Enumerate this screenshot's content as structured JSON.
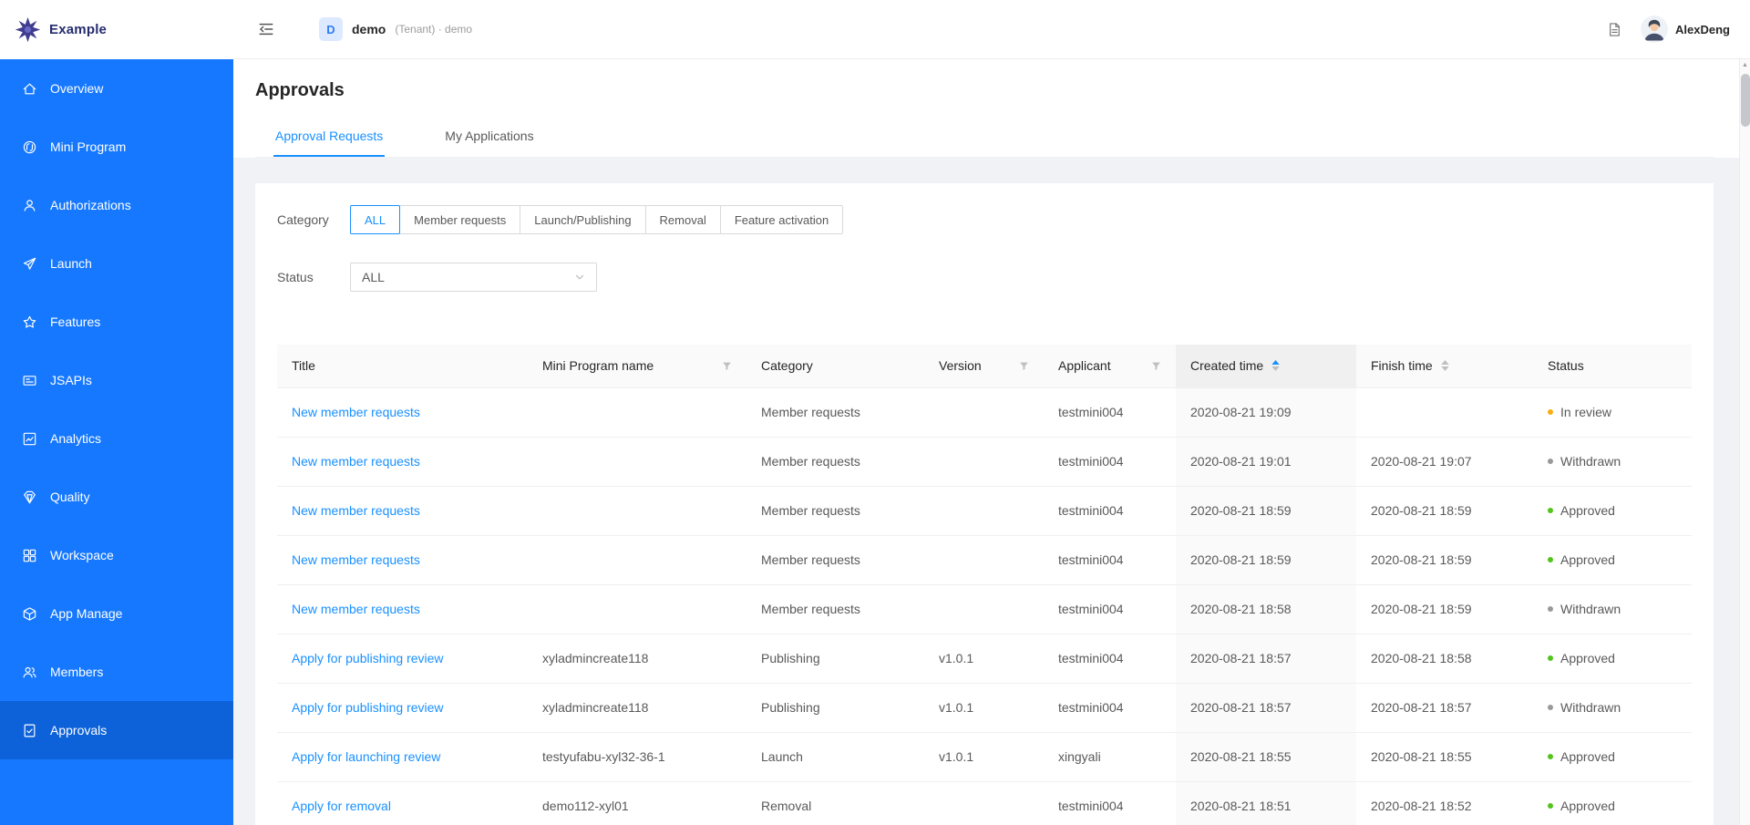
{
  "colors": {
    "accent": "#1890ff",
    "sidebar_background": "#1678ff",
    "status_in_review": "#faad14",
    "status_withdrawn": "#999999",
    "status_approved": "#52c41a"
  },
  "brand": {
    "name": "Example"
  },
  "sidebar": {
    "items": [
      {
        "label": "Overview",
        "icon": "home-icon",
        "active": false
      },
      {
        "label": "Mini Program",
        "icon": "mini-program-icon",
        "active": false
      },
      {
        "label": "Authorizations",
        "icon": "authorizations-icon",
        "active": false
      },
      {
        "label": "Launch",
        "icon": "launch-icon",
        "active": false
      },
      {
        "label": "Features",
        "icon": "features-icon",
        "active": false
      },
      {
        "label": "JSAPIs",
        "icon": "jsapis-icon",
        "active": false
      },
      {
        "label": "Analytics",
        "icon": "analytics-icon",
        "active": false
      },
      {
        "label": "Quality",
        "icon": "quality-icon",
        "active": false
      },
      {
        "label": "Workspace",
        "icon": "workspace-icon",
        "active": false
      },
      {
        "label": "App Manage",
        "icon": "app-manage-icon",
        "active": false
      },
      {
        "label": "Members",
        "icon": "members-icon",
        "active": false
      },
      {
        "label": "Approvals",
        "icon": "approvals-icon",
        "active": true
      }
    ]
  },
  "header": {
    "collapse_icon": "menu-fold-icon",
    "tenant_initial": "D",
    "tenant_name": "demo",
    "tenant_meta": "(Tenant) · demo",
    "docs_icon": "document-icon",
    "user_name": "AlexDeng"
  },
  "page": {
    "title": "Approvals",
    "tabs": [
      {
        "label": "Approval Requests",
        "active": true
      },
      {
        "label": "My Applications",
        "active": false
      }
    ]
  },
  "filters": {
    "category": {
      "label": "Category",
      "options": [
        "ALL",
        "Member requests",
        "Launch/Publishing",
        "Removal",
        "Feature activation"
      ],
      "selected": "ALL"
    },
    "status": {
      "label": "Status",
      "value": "ALL"
    }
  },
  "table": {
    "columns": [
      {
        "label": "Title",
        "filter": false,
        "sorter": false,
        "sorted": false
      },
      {
        "label": "Mini Program name",
        "filter": true,
        "sorter": false,
        "sorted": false
      },
      {
        "label": "Category",
        "filter": false,
        "sorter": false,
        "sorted": false
      },
      {
        "label": "Version",
        "filter": true,
        "sorter": false,
        "sorted": false
      },
      {
        "label": "Applicant",
        "filter": true,
        "sorter": false,
        "sorted": false
      },
      {
        "label": "Created time",
        "filter": false,
        "sorter": true,
        "sorted": true
      },
      {
        "label": "Finish time",
        "filter": false,
        "sorter": true,
        "sorted": false
      },
      {
        "label": "Status",
        "filter": false,
        "sorter": false,
        "sorted": false
      }
    ],
    "rows": [
      {
        "title": "New member requests",
        "mini_program_name": "",
        "category": "Member requests",
        "version": "",
        "applicant": "testmini004",
        "created_time": "2020-08-21 19:09",
        "finish_time": "",
        "status": "In review",
        "status_color": "#faad14"
      },
      {
        "title": "New member requests",
        "mini_program_name": "",
        "category": "Member requests",
        "version": "",
        "applicant": "testmini004",
        "created_time": "2020-08-21 19:01",
        "finish_time": "2020-08-21 19:07",
        "status": "Withdrawn",
        "status_color": "#999999"
      },
      {
        "title": "New member requests",
        "mini_program_name": "",
        "category": "Member requests",
        "version": "",
        "applicant": "testmini004",
        "created_time": "2020-08-21 18:59",
        "finish_time": "2020-08-21 18:59",
        "status": "Approved",
        "status_color": "#52c41a"
      },
      {
        "title": "New member requests",
        "mini_program_name": "",
        "category": "Member requests",
        "version": "",
        "applicant": "testmini004",
        "created_time": "2020-08-21 18:59",
        "finish_time": "2020-08-21 18:59",
        "status": "Approved",
        "status_color": "#52c41a"
      },
      {
        "title": "New member requests",
        "mini_program_name": "",
        "category": "Member requests",
        "version": "",
        "applicant": "testmini004",
        "created_time": "2020-08-21 18:58",
        "finish_time": "2020-08-21 18:59",
        "status": "Withdrawn",
        "status_color": "#999999"
      },
      {
        "title": "Apply for publishing review",
        "mini_program_name": "xyladmincreate118",
        "category": "Publishing",
        "version": "v1.0.1",
        "applicant": "testmini004",
        "created_time": "2020-08-21 18:57",
        "finish_time": "2020-08-21 18:58",
        "status": "Approved",
        "status_color": "#52c41a"
      },
      {
        "title": "Apply for publishing review",
        "mini_program_name": "xyladmincreate118",
        "category": "Publishing",
        "version": "v1.0.1",
        "applicant": "testmini004",
        "created_time": "2020-08-21 18:57",
        "finish_time": "2020-08-21 18:57",
        "status": "Withdrawn",
        "status_color": "#999999"
      },
      {
        "title": "Apply for launching review",
        "mini_program_name": "testyufabu-xyl32-36-1",
        "category": "Launch",
        "version": "v1.0.1",
        "applicant": "xingyali",
        "created_time": "2020-08-21 18:55",
        "finish_time": "2020-08-21 18:55",
        "status": "Approved",
        "status_color": "#52c41a"
      },
      {
        "title": "Apply for removal",
        "mini_program_name": "demo112-xyl01",
        "category": "Removal",
        "version": "",
        "applicant": "testmini004",
        "created_time": "2020-08-21 18:51",
        "finish_time": "2020-08-21 18:52",
        "status": "Approved",
        "status_color": "#52c41a"
      }
    ]
  },
  "scrollbar": {
    "up_arrow": "▲"
  }
}
